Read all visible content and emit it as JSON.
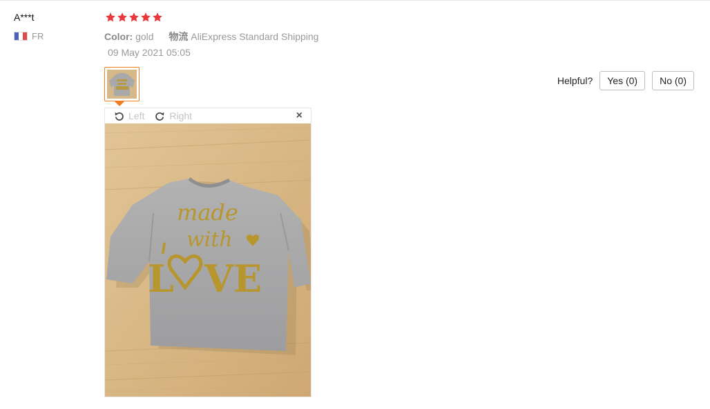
{
  "reviewer": {
    "name": "A***t",
    "country_code": "FR"
  },
  "review": {
    "rating": 5,
    "rating_max": 5,
    "color_label": "Color:",
    "color_value": "gold",
    "shipping_label": "物流",
    "shipping_value": "AliExpress Standard Shipping",
    "date": "09 May 2021 05:05"
  },
  "helpful": {
    "label": "Helpful?",
    "yes_label": "Yes (0)",
    "no_label": "No (0)"
  },
  "viewer": {
    "rotate_left_label": "Left",
    "rotate_right_label": "Right",
    "close_glyph": "×",
    "shirt_text": {
      "line1": "made",
      "line2": "with",
      "line3a": "L",
      "line3b": "VE"
    }
  },
  "colors": {
    "star": "#e8383d",
    "accent_orange": "#f07c1d",
    "muted_text": "#999999",
    "shirt_gray": "#a9a9aa",
    "glitter_gold": "#b8962e",
    "wood": "#d9b98a"
  },
  "icons": {
    "flag": "france-flag-icon",
    "star": "star-icon",
    "rotate_left": "rotate-left-icon",
    "rotate_right": "rotate-right-icon",
    "close": "close-icon"
  }
}
